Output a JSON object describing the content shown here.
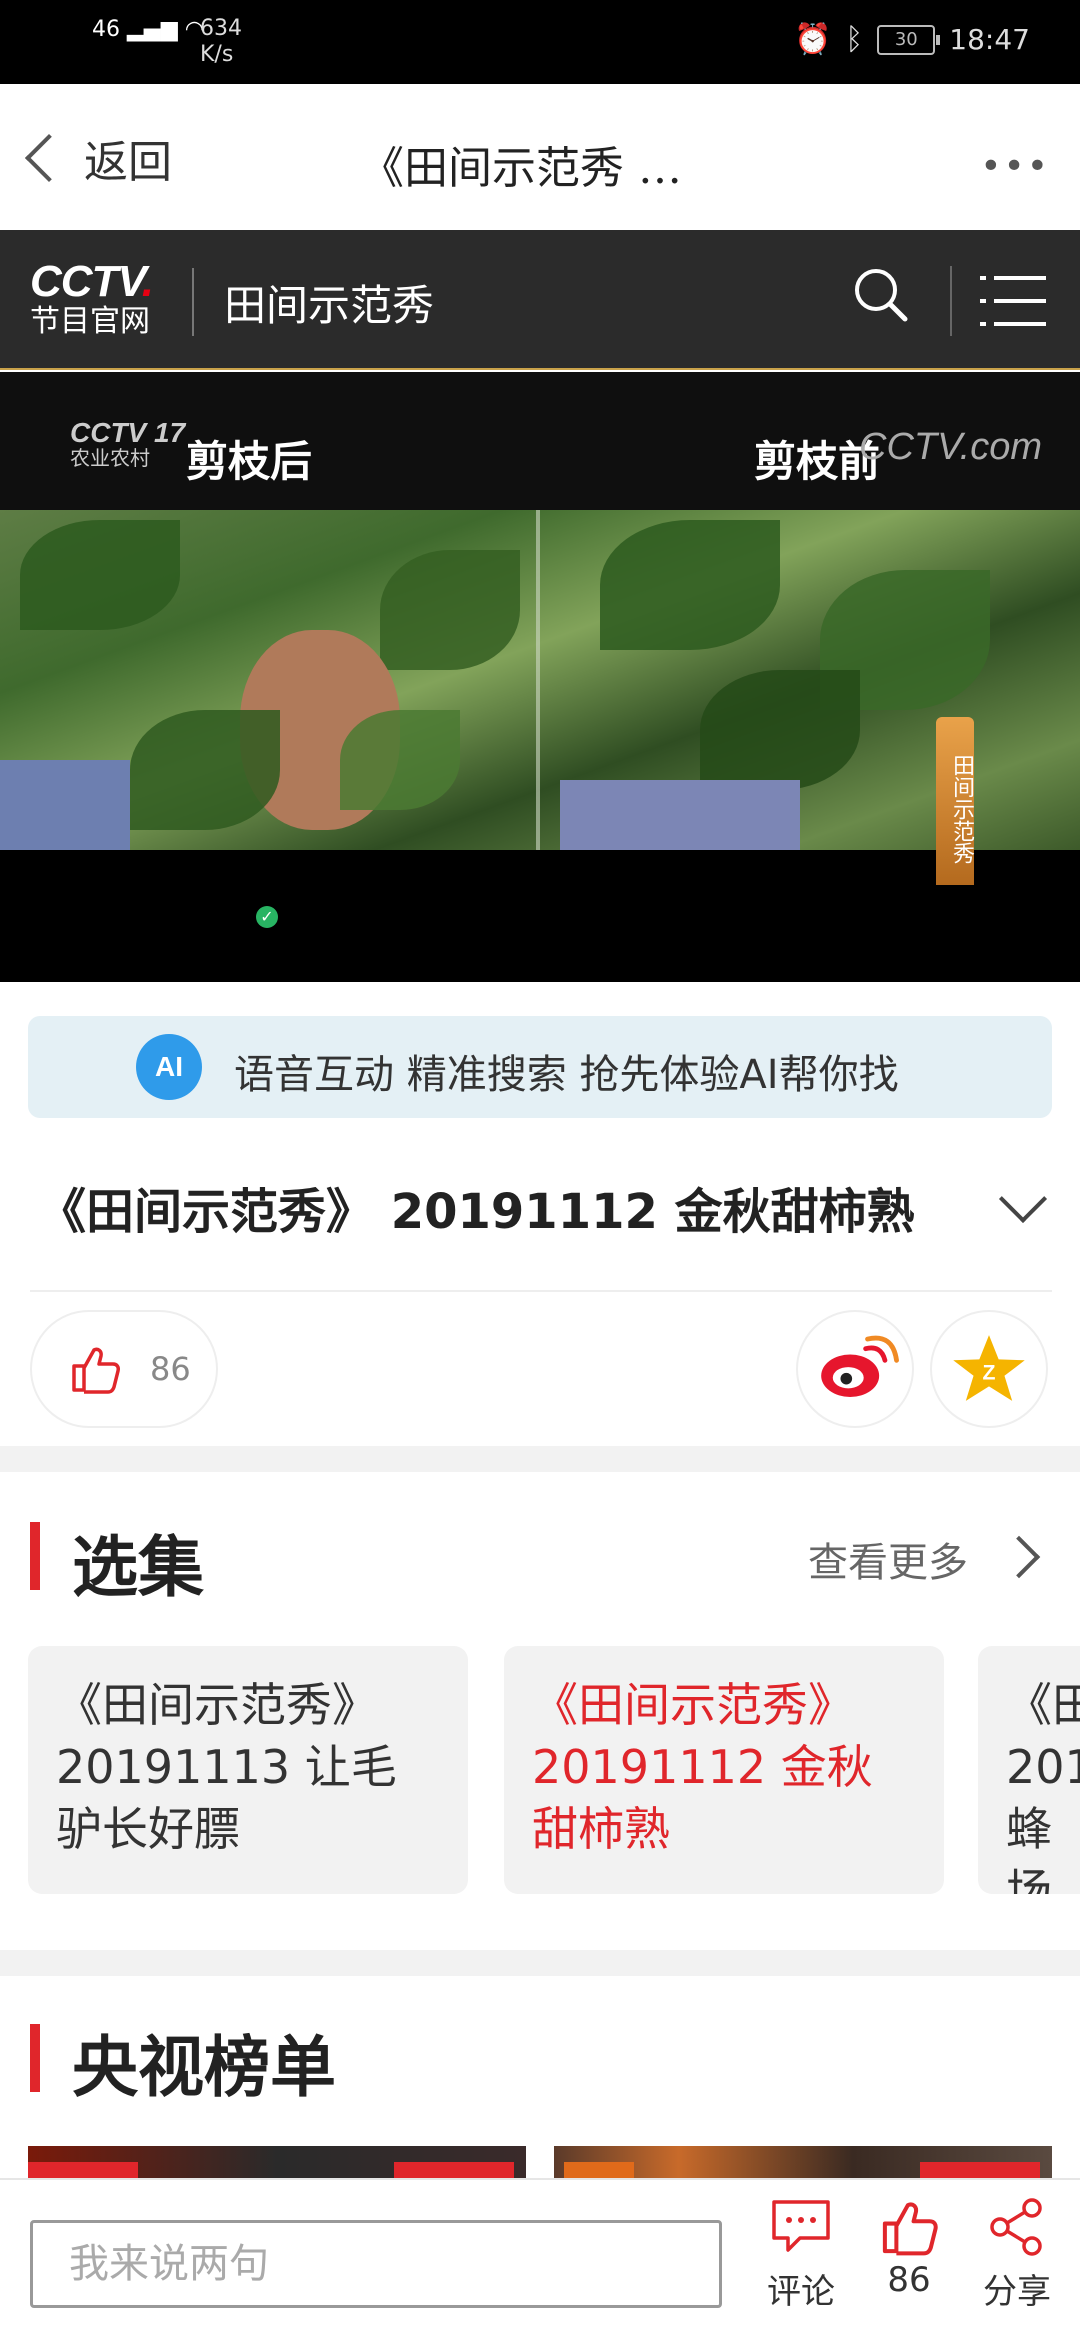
{
  "status_bar": {
    "network": "46",
    "speed_value": "634",
    "speed_unit": "K/s",
    "battery": "30",
    "time": "18:47"
  },
  "titlebar": {
    "back_label": "返回",
    "title": "《田间示范秀 …",
    "more_label": "•••"
  },
  "cctv_header": {
    "logo_top": "CCTV",
    "logo_dot": ".",
    "logo_bottom": "节目官网",
    "program_name": "田间示范秀"
  },
  "video": {
    "channel_logo": "CCTV 17",
    "channel_sub": "农业农村",
    "label_left": "剪枝后",
    "label_right": "剪枝前",
    "watermark": "CCTV.com",
    "caption": "田间示范秀"
  },
  "ai_banner": {
    "icon_text": "AI",
    "text": "语音互动 精准搜索 抢先体验AI帮你找"
  },
  "program_title": "《田间示范秀》 20191112 金秋甜柿熟",
  "actions": {
    "like_count": "86"
  },
  "episodes": {
    "title": "选集",
    "see_more": "查看更多",
    "items": [
      {
        "line1": "《田间示范秀》",
        "line2": "20191113 让毛",
        "line3": "驴长好膘"
      },
      {
        "line1": "《田间示范秀》",
        "line2": "20191112 金秋",
        "line3": "甜柿熟"
      },
      {
        "line1": "《田",
        "line2": "201",
        "line3": "蜂场"
      }
    ]
  },
  "ranking": {
    "title": "央视榜单"
  },
  "bottom_bar": {
    "comment_placeholder": "我来说两句",
    "comment_label": "评论",
    "like_count": "86",
    "share_label": "分享"
  },
  "colors": {
    "accent_red": "#e0262b",
    "header_dark": "#2b2b2b",
    "ai_banner_bg": "#e4f0f5",
    "ai_icon": "#2f9bea"
  }
}
